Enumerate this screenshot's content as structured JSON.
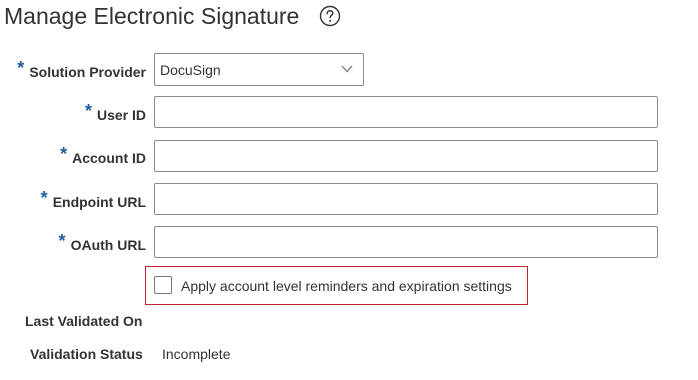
{
  "page": {
    "title": "Manage Electronic Signature",
    "help_icon": "question-circle-icon"
  },
  "form": {
    "required_marker": "*",
    "solution_provider": {
      "label": "Solution Provider",
      "value": "DocuSign"
    },
    "user_id": {
      "label": "User ID",
      "value": ""
    },
    "account_id": {
      "label": "Account ID",
      "value": ""
    },
    "endpoint_url": {
      "label": "Endpoint URL",
      "value": ""
    },
    "oauth_url": {
      "label": "OAuth URL",
      "value": ""
    },
    "reminders_checkbox": {
      "label": "Apply account level reminders and expiration settings",
      "checked": false,
      "highlight_color": "#c0262d"
    },
    "last_validated_on": {
      "label": "Last Validated On",
      "value": ""
    },
    "validation_status": {
      "label": "Validation Status",
      "value": "Incomplete"
    }
  },
  "colors": {
    "required_marker": "#1f5f9f",
    "text": "#333333",
    "border": "#8a8a8a"
  }
}
